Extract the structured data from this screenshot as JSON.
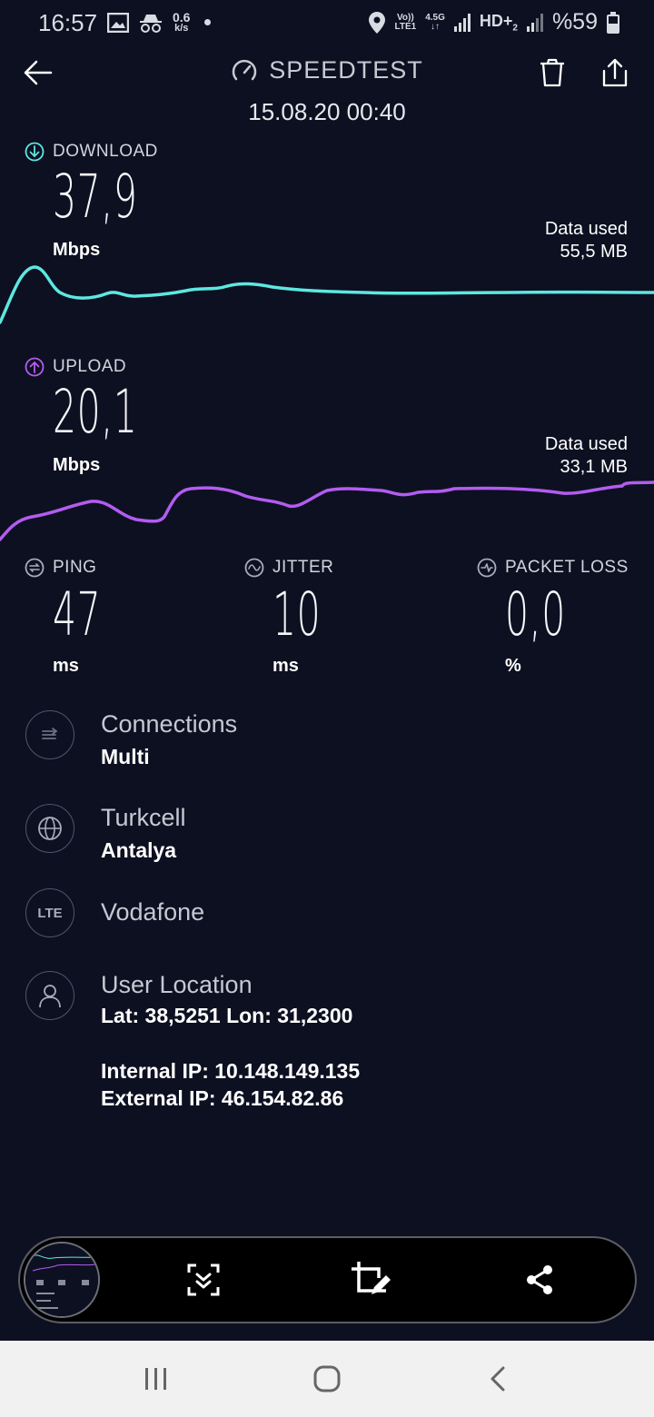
{
  "status_bar": {
    "time": "16:57",
    "net_speed_value": "0.6",
    "net_speed_unit": "k/s",
    "volte_top": "Vo))",
    "volte_bottom": "LTE1",
    "network_type": "4.5G",
    "hd_label": "HD+",
    "hd_sub": "2",
    "battery": "%59"
  },
  "header": {
    "title": "SPEEDTEST",
    "date": "15.08.20 00:40"
  },
  "download": {
    "label": "DOWNLOAD",
    "value": "37,9",
    "unit": "Mbps",
    "data_used_label": "Data used",
    "data_used_value": "55,5 MB",
    "color": "#5de8e0"
  },
  "upload": {
    "label": "UPLOAD",
    "value": "20,1",
    "unit": "Mbps",
    "data_used_label": "Data used",
    "data_used_value": "33,1 MB",
    "color": "#b35cf0"
  },
  "ping": {
    "label": "PING",
    "value": "47",
    "unit": "ms"
  },
  "jitter": {
    "label": "JITTER",
    "value": "10",
    "unit": "ms"
  },
  "packet_loss": {
    "label": "PACKET LOSS",
    "value": "0,0",
    "unit": "%"
  },
  "info": {
    "connections": {
      "title": "Connections",
      "value": "Multi"
    },
    "provider": {
      "title": "Turkcell",
      "value": "Antalya"
    },
    "server": {
      "icon_text": "LTE",
      "title": "Vodafone"
    },
    "location": {
      "title": "User Location",
      "latlon": "Lat: 38,5251 Lon: 31,2300",
      "internal_ip": "Internal IP: 10.148.149.135",
      "external_ip": "External IP: 46.154.82.86"
    }
  },
  "capture_toolbar": {
    "icons": [
      "scroll-capture-icon",
      "crop-edit-icon",
      "share-icon"
    ]
  },
  "nav": {
    "icons": [
      "recent-apps-icon",
      "home-icon",
      "back-icon"
    ]
  }
}
